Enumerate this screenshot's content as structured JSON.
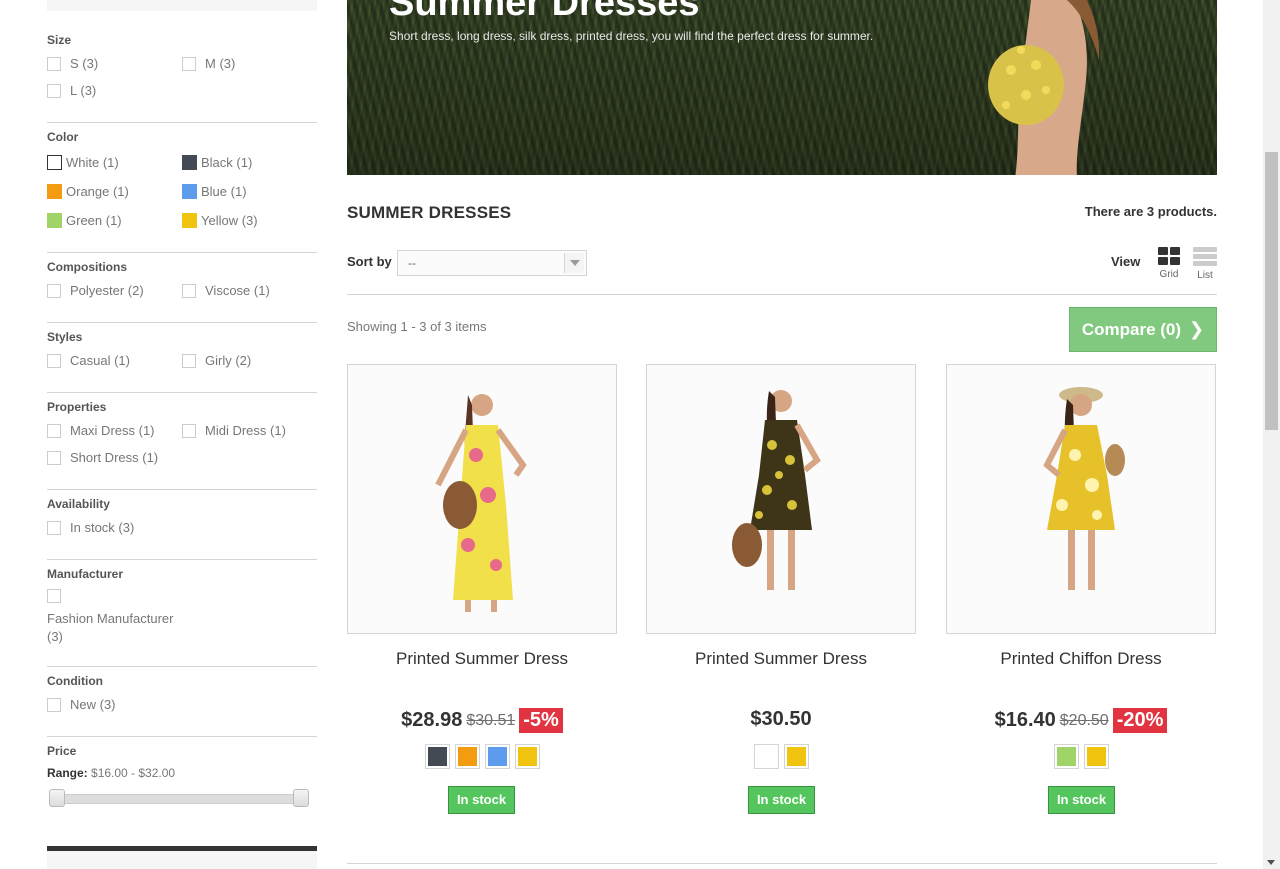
{
  "filters": {
    "size": {
      "title": "Size",
      "options": [
        "S (3)",
        "M (3)",
        "L (3)"
      ]
    },
    "color": {
      "title": "Color",
      "options": [
        {
          "label": "White (1)",
          "color": "#ffffff"
        },
        {
          "label": "Black (1)",
          "color": "#434a54"
        },
        {
          "label": "Orange (1)",
          "color": "#f39c11"
        },
        {
          "label": "Blue (1)",
          "color": "#5d9cec"
        },
        {
          "label": "Green (1)",
          "color": "#a0d468"
        },
        {
          "label": "Yellow (3)",
          "color": "#f1c40f"
        }
      ]
    },
    "compositions": {
      "title": "Compositions",
      "options": [
        "Polyester (2)",
        "Viscose (1)"
      ]
    },
    "styles": {
      "title": "Styles",
      "options": [
        "Casual (1)",
        "Girly (2)"
      ]
    },
    "properties": {
      "title": "Properties",
      "options": [
        "Maxi Dress (1)",
        "Midi Dress (1)",
        "Short Dress (1)"
      ]
    },
    "availability": {
      "title": "Availability",
      "options": [
        "In stock (3)"
      ]
    },
    "manufacturer": {
      "title": "Manufacturer",
      "options": [
        "Fashion Manufacturer",
        "(3)"
      ]
    },
    "condition": {
      "title": "Condition",
      "options": [
        "New (3)"
      ]
    },
    "price": {
      "title": "Price",
      "range_label": "Range:",
      "range_value": "$16.00 - $32.00"
    }
  },
  "banner": {
    "title": "Summer Dresses",
    "subtitle": "Short dress, long dress, silk dress, printed dress, you will find the perfect dress for summer."
  },
  "category": {
    "heading": "SUMMER DRESSES",
    "count_text": "There are 3 products."
  },
  "toolbar": {
    "sort_label": "Sort by",
    "sort_value": "--",
    "view_label": "View",
    "grid_label": "Grid",
    "list_label": "List",
    "showing": "Showing 1 - 3 of 3 items",
    "compare_label": "Compare (0)"
  },
  "products": [
    {
      "name": "Printed Summer Dress",
      "price": "$28.98",
      "old_price": "$30.51",
      "reduction": "-5%",
      "colors": [
        "#434a54",
        "#f39c11",
        "#5d9cec",
        "#f1c40f"
      ],
      "stock": "In stock"
    },
    {
      "name": "Printed Summer Dress",
      "price": "$30.50",
      "old_price": "",
      "reduction": "",
      "colors": [
        "#ffffff",
        "#f1c40f"
      ],
      "stock": "In stock"
    },
    {
      "name": "Printed Chiffon Dress",
      "price": "$16.40",
      "old_price": "$20.50",
      "reduction": "-20%",
      "colors": [
        "#a0d468",
        "#f1c40f"
      ],
      "stock": "In stock"
    }
  ]
}
